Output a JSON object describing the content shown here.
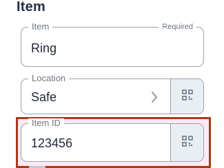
{
  "section": {
    "title": "Item"
  },
  "fields": {
    "item": {
      "label": "Item",
      "required_label": "Required",
      "value": "Ring"
    },
    "location": {
      "label": "Location",
      "value": "Safe"
    },
    "item_id": {
      "label": "Item ID",
      "value": "123456"
    }
  },
  "colors": {
    "title": "#233049",
    "border": "#9aa0a9",
    "highlight_border": "#a83a1c",
    "highlight_fill": "#fce9f4",
    "scan_button_bg": "#e9eef3",
    "icon": "#5b6a7c"
  },
  "icons": {
    "location_chevron": "chevron-right-icon",
    "scan": "qr-scan-icon"
  }
}
